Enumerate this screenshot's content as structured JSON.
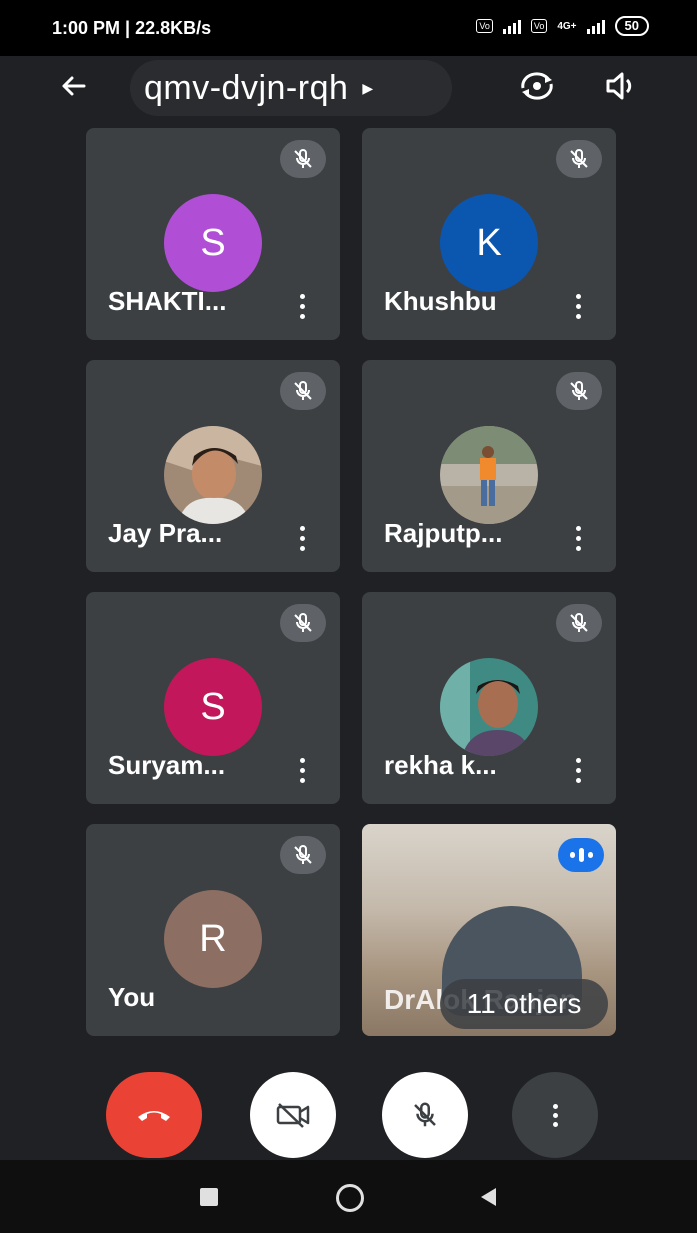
{
  "status_bar": {
    "time_speed": "1:00 PM | 22.8KB/s",
    "sim_badge_1": "Vo LTE",
    "sim_badge_2": "Vo LTE",
    "network": "4G+",
    "battery": "50"
  },
  "header": {
    "meeting_code": "qmv-dvjn-rqh",
    "back_icon": "arrow-left-icon",
    "switch_camera_icon": "switch-camera-icon",
    "speaker_icon": "speaker-icon"
  },
  "participants": [
    {
      "name": "SHAKTI...",
      "initial": "S",
      "avatar_color": "#b14ed6",
      "muted": true
    },
    {
      "name": "Khushbu",
      "initial": "K",
      "avatar_color": "#0b57b0",
      "muted": true
    },
    {
      "name": "Jay Pra...",
      "avatar": "photo",
      "muted": true
    },
    {
      "name": "Rajputp...",
      "avatar": "photo",
      "muted": true
    },
    {
      "name": "Suryam...",
      "initial": "S",
      "avatar_color": "#c2185b",
      "muted": true
    },
    {
      "name": "rekha k...",
      "avatar": "photo",
      "muted": true
    },
    {
      "name": "You",
      "initial": "R",
      "avatar_color": "#8d6e63",
      "muted": true
    }
  ],
  "video_tile": {
    "name": "DrAlok Ranjan",
    "others_label": "11 others",
    "speaking": true
  },
  "controls": {
    "end_call_color": "#ea4335",
    "end_call_icon": "phone-hangup-icon",
    "camera_icon": "camera-off-icon",
    "mic_icon": "mic-off-icon",
    "more_icon": "more-vert-icon"
  },
  "nav": {
    "recents_icon": "square-icon",
    "home_icon": "circle-icon",
    "back_icon": "triangle-back-icon"
  }
}
